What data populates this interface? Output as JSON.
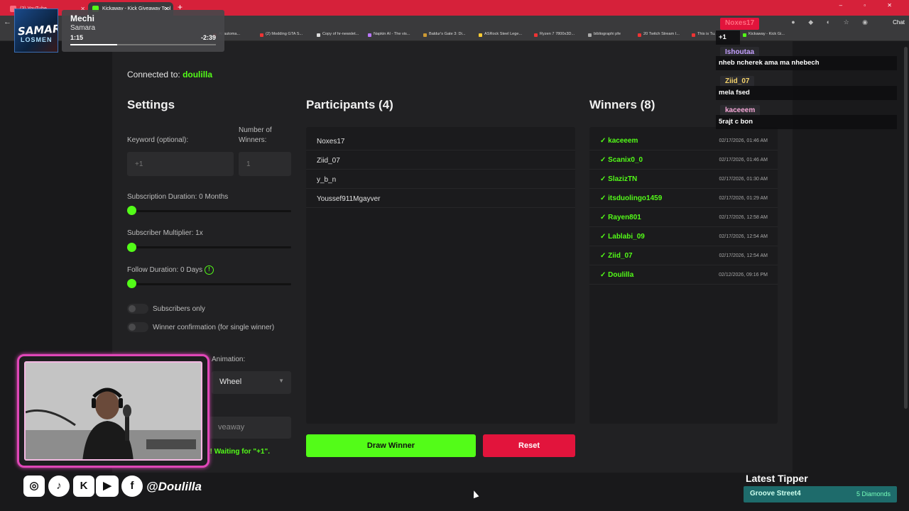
{
  "browser": {
    "tabs": [
      {
        "label": "(3) YouTube"
      },
      {
        "label": "Kickaway - Kick Giveaway Tool"
      }
    ],
    "new_tab": "+",
    "window_controls": "– ▫ ✕",
    "back": "←",
    "chat_button": "Chat",
    "bookmarks": [
      {
        "label": "AI automa...",
        "color": "#e33"
      },
      {
        "label": "(2) Modding GTA S...",
        "color": "#e33"
      },
      {
        "label": "Copy of hr-newslet...",
        "color": "#ddd"
      },
      {
        "label": "Napkin AI - The vis...",
        "color": "#b7f"
      },
      {
        "label": "Baldur's Gate 3: Di...",
        "color": "#c93"
      },
      {
        "label": "ASRock Steel Lege...",
        "color": "#fc3"
      },
      {
        "label": "Ryzen 7 7800x3D...",
        "color": "#e33"
      },
      {
        "label": "bibliographi pfe",
        "color": "#aaa"
      },
      {
        "label": "20 Twitch Stream I...",
        "color": "#e33"
      },
      {
        "label": "This is Tu...",
        "color": "#e33"
      },
      {
        "label": "Kickaway - Kick Gi...",
        "color": "#53fc18"
      }
    ]
  },
  "app": {
    "connected_label": "Connected to:",
    "channel": "doulilla",
    "settings": {
      "title": "Settings",
      "keyword_label": "Keyword (optional):",
      "keyword_placeholder": "+1",
      "winners_label": "Number of Winners:",
      "winners_value": "1",
      "subscription_duration": "Subscription Duration: 0 Months",
      "subscriber_multiplier": "Subscriber Multiplier: 1x",
      "follow_duration": "Follow Duration: 0 Days",
      "info_glyph": "!",
      "subscribers_only": "Subscribers only",
      "winner_confirmation": "Winner confirmation (for single winner)",
      "animation_label": "Animation:",
      "animation_value": "Wheel",
      "start_button_partial": "veaway",
      "status_partial": "t! Waiting for \"+1\"."
    },
    "participants": {
      "title": "Participants (4)",
      "items": [
        "Noxes17",
        "Ziid_07",
        "y_b_n",
        "Youssef911Mgayver"
      ]
    },
    "winners": {
      "title": "Winners (8)",
      "items": [
        {
          "name": "✓ kaceeem",
          "time": "02/17/2026, 01:46 AM"
        },
        {
          "name": "✓ Scanix0_0",
          "time": "02/17/2026, 01:46 AM"
        },
        {
          "name": "✓ SlazizTN",
          "time": "02/17/2026, 01:30 AM"
        },
        {
          "name": "✓ itsduolingo1459",
          "time": "02/17/2026, 01:29 AM"
        },
        {
          "name": "✓ Rayen801",
          "time": "02/17/2026, 12:58 AM"
        },
        {
          "name": "✓ Lablabi_09",
          "time": "02/17/2026, 12:54 AM"
        },
        {
          "name": "✓ Ziid_07",
          "time": "02/17/2026, 12:54 AM"
        },
        {
          "name": "✓ Doulilla",
          "time": "02/12/2026, 09:16 PM"
        }
      ]
    },
    "draw_button": "Draw Winner",
    "reset_button": "Reset"
  },
  "music": {
    "album_text": "SAMARA",
    "album_sub": "LOSMEN",
    "title": "Mechi",
    "artist": "Samara",
    "elapsed": "1:15",
    "remaining": "-2:39",
    "progress_fraction": 0.32
  },
  "chat": {
    "messages": [
      {
        "user": "Noxes17",
        "text": "+1",
        "color": "#e2143c",
        "text_color": "#ff6b7f"
      },
      {
        "user": "Ishoutaa",
        "text": "nheb ncherek ama ma nhebech",
        "color": "#2a2a2e",
        "text_color": "#c4a0ff"
      },
      {
        "user": "Ziid_07",
        "text": "mela fsed",
        "color": "#2a2a2e",
        "text_color": "#f5d36b"
      },
      {
        "user": "kaceeem",
        "text": "5rajt c bon",
        "color": "#2a2a2e",
        "text_color": "#f7a8d8"
      }
    ]
  },
  "social": {
    "handle": "@Doulilla",
    "icons": [
      {
        "name": "instagram-icon",
        "glyph": "◎"
      },
      {
        "name": "tiktok-icon",
        "glyph": "♪"
      },
      {
        "name": "kick-icon",
        "glyph": "K"
      },
      {
        "name": "youtube-icon",
        "glyph": "▶"
      },
      {
        "name": "facebook-icon",
        "glyph": "f"
      }
    ]
  },
  "tipper": {
    "title": "Latest Tipper",
    "name": "Groove Street4",
    "amount": "5 Diamonds"
  },
  "colors": {
    "accent": "#53fc18",
    "danger": "#e2143c",
    "webcam_border": "#e047b8"
  }
}
